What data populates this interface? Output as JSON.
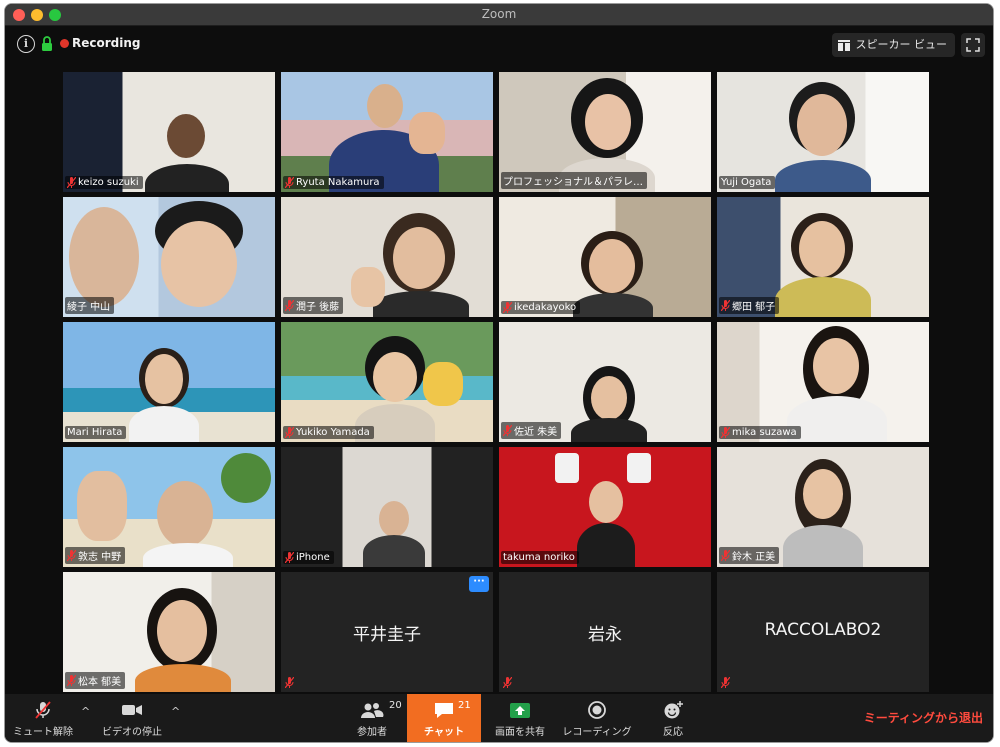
{
  "window": {
    "title": "Zoom"
  },
  "topbar": {
    "recording_label": "Recording",
    "speaker_view_label": "スピーカー ビュー"
  },
  "tiles": [
    {
      "name": "keizo suzuki"
    },
    {
      "name": "Ryuta Nakamura"
    },
    {
      "name": "プロフェッショナル＆パラレ…"
    },
    {
      "name": "Yuji Ogata"
    },
    {
      "name": "綾子 中山"
    },
    {
      "name": "潤子 後藤"
    },
    {
      "name": "ikedakayoko"
    },
    {
      "name": "郷田 郁子"
    },
    {
      "name": "Mari Hirata"
    },
    {
      "name": "Yukiko Yamada"
    },
    {
      "name": "佐近 朱美"
    },
    {
      "name": "mika suzawa"
    },
    {
      "name": "敦志 中野"
    },
    {
      "name": "iPhone"
    },
    {
      "name": "takuma noriko"
    },
    {
      "name": "鈴木 正美"
    },
    {
      "name": "松本 郁美"
    },
    {
      "name": "平井圭子"
    },
    {
      "name": "岩永"
    },
    {
      "name": "RACCOLABO2"
    }
  ],
  "toolbar": {
    "unmute_label": "ミュート解除",
    "stop_video_label": "ビデオの停止",
    "participants_label": "参加者",
    "participants_count": "20",
    "chat_label": "チャット",
    "chat_count": "21",
    "share_label": "画面を共有",
    "record_label": "レコーディング",
    "reactions_label": "反応",
    "leave_label": "ミーティングから退出"
  },
  "colors": {
    "accent_orange": "#f26d21",
    "leave_red": "#ff4b3e",
    "active_speaker": "#c6e25a",
    "share_green": "#23a04a",
    "more_blue": "#2d8cff"
  }
}
